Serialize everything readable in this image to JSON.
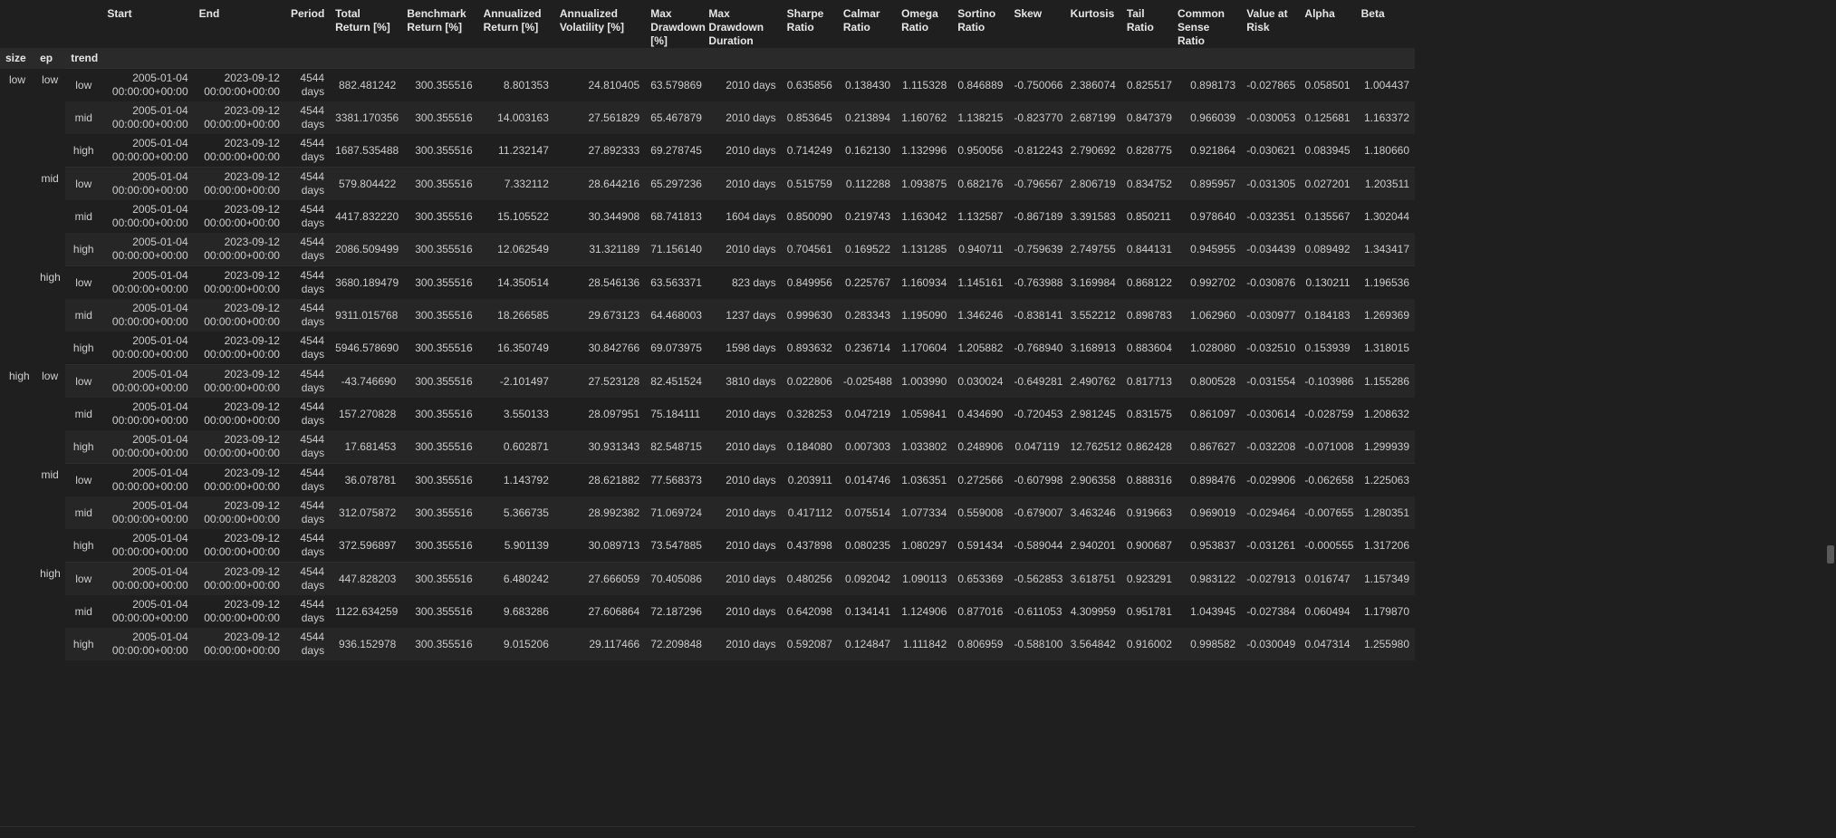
{
  "columns": [
    "",
    "",
    "",
    "Start",
    "End",
    "Period",
    "Total Return [%]",
    "Benchmark Return [%]",
    "Annualized Return [%]",
    "Annualized Volatility [%]",
    "Max Drawdown [%]",
    "Max Drawdown Duration",
    "Sharpe Ratio",
    "Calmar Ratio",
    "Omega Ratio",
    "Sortino Ratio",
    "Skew",
    "Kurtosis",
    "Tail Ratio",
    "Common Sense Ratio",
    "Value at Risk",
    "Alpha",
    "Beta"
  ],
  "index_names": [
    "size",
    "ep",
    "trend"
  ],
  "rows": [
    {
      "size": "low",
      "ep": "low",
      "trend": "low",
      "start_date": "2005-01-04",
      "start_time": "00:00:00+00:00",
      "end_date": "2023-09-12",
      "end_time": "00:00:00+00:00",
      "period_num": "4544",
      "period_unit": "days",
      "total_return": "882.481242",
      "benchmark": "300.355516",
      "ann_return": "8.801353",
      "ann_vol": "24.810405",
      "max_dd": "63.579869",
      "dd_dur": "2010 days",
      "sharpe": "0.635856",
      "calmar": "0.138430",
      "omega": "1.115328",
      "sortino": "0.846889",
      "skew": "-0.750066",
      "kurtosis": "2.386074",
      "tail": "0.825517",
      "csr": "0.898173",
      "var": "-0.027865",
      "alpha": "0.058501",
      "beta": "1.004437"
    },
    {
      "size": "",
      "ep": "",
      "trend": "mid",
      "start_date": "2005-01-04",
      "start_time": "00:00:00+00:00",
      "end_date": "2023-09-12",
      "end_time": "00:00:00+00:00",
      "period_num": "4544",
      "period_unit": "days",
      "total_return": "3381.170356",
      "benchmark": "300.355516",
      "ann_return": "14.003163",
      "ann_vol": "27.561829",
      "max_dd": "65.467879",
      "dd_dur": "2010 days",
      "sharpe": "0.853645",
      "calmar": "0.213894",
      "omega": "1.160762",
      "sortino": "1.138215",
      "skew": "-0.823770",
      "kurtosis": "2.687199",
      "tail": "0.847379",
      "csr": "0.966039",
      "var": "-0.030053",
      "alpha": "0.125681",
      "beta": "1.163372"
    },
    {
      "size": "",
      "ep": "",
      "trend": "high",
      "start_date": "2005-01-04",
      "start_time": "00:00:00+00:00",
      "end_date": "2023-09-12",
      "end_time": "00:00:00+00:00",
      "period_num": "4544",
      "period_unit": "days",
      "total_return": "1687.535488",
      "benchmark": "300.355516",
      "ann_return": "11.232147",
      "ann_vol": "27.892333",
      "max_dd": "69.278745",
      "dd_dur": "2010 days",
      "sharpe": "0.714249",
      "calmar": "0.162130",
      "omega": "1.132996",
      "sortino": "0.950056",
      "skew": "-0.812243",
      "kurtosis": "2.790692",
      "tail": "0.828775",
      "csr": "0.921864",
      "var": "-0.030621",
      "alpha": "0.083945",
      "beta": "1.180660"
    },
    {
      "size": "",
      "ep": "mid",
      "trend": "low",
      "start_date": "2005-01-04",
      "start_time": "00:00:00+00:00",
      "end_date": "2023-09-12",
      "end_time": "00:00:00+00:00",
      "period_num": "4544",
      "period_unit": "days",
      "total_return": "579.804422",
      "benchmark": "300.355516",
      "ann_return": "7.332112",
      "ann_vol": "28.644216",
      "max_dd": "65.297236",
      "dd_dur": "2010 days",
      "sharpe": "0.515759",
      "calmar": "0.112288",
      "omega": "1.093875",
      "sortino": "0.682176",
      "skew": "-0.796567",
      "kurtosis": "2.806719",
      "tail": "0.834752",
      "csr": "0.895957",
      "var": "-0.031305",
      "alpha": "0.027201",
      "beta": "1.203511"
    },
    {
      "size": "",
      "ep": "",
      "trend": "mid",
      "start_date": "2005-01-04",
      "start_time": "00:00:00+00:00",
      "end_date": "2023-09-12",
      "end_time": "00:00:00+00:00",
      "period_num": "4544",
      "period_unit": "days",
      "total_return": "4417.832220",
      "benchmark": "300.355516",
      "ann_return": "15.105522",
      "ann_vol": "30.344908",
      "max_dd": "68.741813",
      "dd_dur": "1604 days",
      "sharpe": "0.850090",
      "calmar": "0.219743",
      "omega": "1.163042",
      "sortino": "1.132587",
      "skew": "-0.867189",
      "kurtosis": "3.391583",
      "tail": "0.850211",
      "csr": "0.978640",
      "var": "-0.032351",
      "alpha": "0.135567",
      "beta": "1.302044"
    },
    {
      "size": "",
      "ep": "",
      "trend": "high",
      "start_date": "2005-01-04",
      "start_time": "00:00:00+00:00",
      "end_date": "2023-09-12",
      "end_time": "00:00:00+00:00",
      "period_num": "4544",
      "period_unit": "days",
      "total_return": "2086.509499",
      "benchmark": "300.355516",
      "ann_return": "12.062549",
      "ann_vol": "31.321189",
      "max_dd": "71.156140",
      "dd_dur": "2010 days",
      "sharpe": "0.704561",
      "calmar": "0.169522",
      "omega": "1.131285",
      "sortino": "0.940711",
      "skew": "-0.759639",
      "kurtosis": "2.749755",
      "tail": "0.844131",
      "csr": "0.945955",
      "var": "-0.034439",
      "alpha": "0.089492",
      "beta": "1.343417"
    },
    {
      "size": "",
      "ep": "high",
      "trend": "low",
      "start_date": "2005-01-04",
      "start_time": "00:00:00+00:00",
      "end_date": "2023-09-12",
      "end_time": "00:00:00+00:00",
      "period_num": "4544",
      "period_unit": "days",
      "total_return": "3680.189479",
      "benchmark": "300.355516",
      "ann_return": "14.350514",
      "ann_vol": "28.546136",
      "max_dd": "63.563371",
      "dd_dur": "823 days",
      "sharpe": "0.849956",
      "calmar": "0.225767",
      "omega": "1.160934",
      "sortino": "1.145161",
      "skew": "-0.763988",
      "kurtosis": "3.169984",
      "tail": "0.868122",
      "csr": "0.992702",
      "var": "-0.030876",
      "alpha": "0.130211",
      "beta": "1.196536"
    },
    {
      "size": "",
      "ep": "",
      "trend": "mid",
      "start_date": "2005-01-04",
      "start_time": "00:00:00+00:00",
      "end_date": "2023-09-12",
      "end_time": "00:00:00+00:00",
      "period_num": "4544",
      "period_unit": "days",
      "total_return": "9311.015768",
      "benchmark": "300.355516",
      "ann_return": "18.266585",
      "ann_vol": "29.673123",
      "max_dd": "64.468003",
      "dd_dur": "1237 days",
      "sharpe": "0.999630",
      "calmar": "0.283343",
      "omega": "1.195090",
      "sortino": "1.346246",
      "skew": "-0.838141",
      "kurtosis": "3.552212",
      "tail": "0.898783",
      "csr": "1.062960",
      "var": "-0.030977",
      "alpha": "0.184183",
      "beta": "1.269369"
    },
    {
      "size": "",
      "ep": "",
      "trend": "high",
      "start_date": "2005-01-04",
      "start_time": "00:00:00+00:00",
      "end_date": "2023-09-12",
      "end_time": "00:00:00+00:00",
      "period_num": "4544",
      "period_unit": "days",
      "total_return": "5946.578690",
      "benchmark": "300.355516",
      "ann_return": "16.350749",
      "ann_vol": "30.842766",
      "max_dd": "69.073975",
      "dd_dur": "1598 days",
      "sharpe": "0.893632",
      "calmar": "0.236714",
      "omega": "1.170604",
      "sortino": "1.205882",
      "skew": "-0.768940",
      "kurtosis": "3.168913",
      "tail": "0.883604",
      "csr": "1.028080",
      "var": "-0.032510",
      "alpha": "0.153939",
      "beta": "1.318015"
    },
    {
      "size": "high",
      "ep": "low",
      "trend": "low",
      "start_date": "2005-01-04",
      "start_time": "00:00:00+00:00",
      "end_date": "2023-09-12",
      "end_time": "00:00:00+00:00",
      "period_num": "4544",
      "period_unit": "days",
      "total_return": "-43.746690",
      "benchmark": "300.355516",
      "ann_return": "-2.101497",
      "ann_vol": "27.523128",
      "max_dd": "82.451524",
      "dd_dur": "3810 days",
      "sharpe": "0.022806",
      "calmar": "-0.025488",
      "omega": "1.003990",
      "sortino": "0.030024",
      "skew": "-0.649281",
      "kurtosis": "2.490762",
      "tail": "0.817713",
      "csr": "0.800528",
      "var": "-0.031554",
      "alpha": "-0.103986",
      "beta": "1.155286"
    },
    {
      "size": "",
      "ep": "",
      "trend": "mid",
      "start_date": "2005-01-04",
      "start_time": "00:00:00+00:00",
      "end_date": "2023-09-12",
      "end_time": "00:00:00+00:00",
      "period_num": "4544",
      "period_unit": "days",
      "total_return": "157.270828",
      "benchmark": "300.355516",
      "ann_return": "3.550133",
      "ann_vol": "28.097951",
      "max_dd": "75.184111",
      "dd_dur": "2010 days",
      "sharpe": "0.328253",
      "calmar": "0.047219",
      "omega": "1.059841",
      "sortino": "0.434690",
      "skew": "-0.720453",
      "kurtosis": "2.981245",
      "tail": "0.831575",
      "csr": "0.861097",
      "var": "-0.030614",
      "alpha": "-0.028759",
      "beta": "1.208632"
    },
    {
      "size": "",
      "ep": "",
      "trend": "high",
      "start_date": "2005-01-04",
      "start_time": "00:00:00+00:00",
      "end_date": "2023-09-12",
      "end_time": "00:00:00+00:00",
      "period_num": "4544",
      "period_unit": "days",
      "total_return": "17.681453",
      "benchmark": "300.355516",
      "ann_return": "0.602871",
      "ann_vol": "30.931343",
      "max_dd": "82.548715",
      "dd_dur": "2010 days",
      "sharpe": "0.184080",
      "calmar": "0.007303",
      "omega": "1.033802",
      "sortino": "0.248906",
      "skew": "0.047119",
      "kurtosis": "12.762512",
      "tail": "0.862428",
      "csr": "0.867627",
      "var": "-0.032208",
      "alpha": "-0.071008",
      "beta": "1.299939"
    },
    {
      "size": "",
      "ep": "mid",
      "trend": "low",
      "start_date": "2005-01-04",
      "start_time": "00:00:00+00:00",
      "end_date": "2023-09-12",
      "end_time": "00:00:00+00:00",
      "period_num": "4544",
      "period_unit": "days",
      "total_return": "36.078781",
      "benchmark": "300.355516",
      "ann_return": "1.143792",
      "ann_vol": "28.621882",
      "max_dd": "77.568373",
      "dd_dur": "2010 days",
      "sharpe": "0.203911",
      "calmar": "0.014746",
      "omega": "1.036351",
      "sortino": "0.272566",
      "skew": "-0.607998",
      "kurtosis": "2.906358",
      "tail": "0.888316",
      "csr": "0.898476",
      "var": "-0.029906",
      "alpha": "-0.062658",
      "beta": "1.225063"
    },
    {
      "size": "",
      "ep": "",
      "trend": "mid",
      "start_date": "2005-01-04",
      "start_time": "00:00:00+00:00",
      "end_date": "2023-09-12",
      "end_time": "00:00:00+00:00",
      "period_num": "4544",
      "period_unit": "days",
      "total_return": "312.075872",
      "benchmark": "300.355516",
      "ann_return": "5.366735",
      "ann_vol": "28.992382",
      "max_dd": "71.069724",
      "dd_dur": "2010 days",
      "sharpe": "0.417112",
      "calmar": "0.075514",
      "omega": "1.077334",
      "sortino": "0.559008",
      "skew": "-0.679007",
      "kurtosis": "3.463246",
      "tail": "0.919663",
      "csr": "0.969019",
      "var": "-0.029464",
      "alpha": "-0.007655",
      "beta": "1.280351"
    },
    {
      "size": "",
      "ep": "",
      "trend": "high",
      "start_date": "2005-01-04",
      "start_time": "00:00:00+00:00",
      "end_date": "2023-09-12",
      "end_time": "00:00:00+00:00",
      "period_num": "4544",
      "period_unit": "days",
      "total_return": "372.596897",
      "benchmark": "300.355516",
      "ann_return": "5.901139",
      "ann_vol": "30.089713",
      "max_dd": "73.547885",
      "dd_dur": "2010 days",
      "sharpe": "0.437898",
      "calmar": "0.080235",
      "omega": "1.080297",
      "sortino": "0.591434",
      "skew": "-0.589044",
      "kurtosis": "2.940201",
      "tail": "0.900687",
      "csr": "0.953837",
      "var": "-0.031261",
      "alpha": "-0.000555",
      "beta": "1.317206"
    },
    {
      "size": "",
      "ep": "high",
      "trend": "low",
      "start_date": "2005-01-04",
      "start_time": "00:00:00+00:00",
      "end_date": "2023-09-12",
      "end_time": "00:00:00+00:00",
      "period_num": "4544",
      "period_unit": "days",
      "total_return": "447.828203",
      "benchmark": "300.355516",
      "ann_return": "6.480242",
      "ann_vol": "27.666059",
      "max_dd": "70.405086",
      "dd_dur": "2010 days",
      "sharpe": "0.480256",
      "calmar": "0.092042",
      "omega": "1.090113",
      "sortino": "0.653369",
      "skew": "-0.562853",
      "kurtosis": "3.618751",
      "tail": "0.923291",
      "csr": "0.983122",
      "var": "-0.027913",
      "alpha": "0.016747",
      "beta": "1.157349"
    },
    {
      "size": "",
      "ep": "",
      "trend": "mid",
      "start_date": "2005-01-04",
      "start_time": "00:00:00+00:00",
      "end_date": "2023-09-12",
      "end_time": "00:00:00+00:00",
      "period_num": "4544",
      "period_unit": "days",
      "total_return": "1122.634259",
      "benchmark": "300.355516",
      "ann_return": "9.683286",
      "ann_vol": "27.606864",
      "max_dd": "72.187296",
      "dd_dur": "2010 days",
      "sharpe": "0.642098",
      "calmar": "0.134141",
      "omega": "1.124906",
      "sortino": "0.877016",
      "skew": "-0.611053",
      "kurtosis": "4.309959",
      "tail": "0.951781",
      "csr": "1.043945",
      "var": "-0.027384",
      "alpha": "0.060494",
      "beta": "1.179870"
    },
    {
      "size": "",
      "ep": "",
      "trend": "high",
      "start_date": "2005-01-04",
      "start_time": "00:00:00+00:00",
      "end_date": "2023-09-12",
      "end_time": "00:00:00+00:00",
      "period_num": "4544",
      "period_unit": "days",
      "total_return": "936.152978",
      "benchmark": "300.355516",
      "ann_return": "9.015206",
      "ann_vol": "29.117466",
      "max_dd": "72.209848",
      "dd_dur": "2010 days",
      "sharpe": "0.592087",
      "calmar": "0.124847",
      "omega": "1.111842",
      "sortino": "0.806959",
      "skew": "-0.588100",
      "kurtosis": "3.564842",
      "tail": "0.916002",
      "csr": "0.998582",
      "var": "-0.030049",
      "alpha": "0.047314",
      "beta": "1.255980"
    }
  ]
}
